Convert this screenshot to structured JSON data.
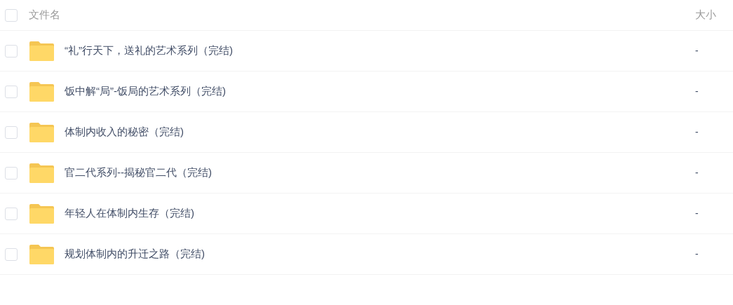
{
  "header": {
    "checked": false,
    "columns": [
      "文件名",
      "大小"
    ]
  },
  "rows": [
    {
      "checked": false,
      "name": "“礼”行天下，送礼的艺术系列（完结)",
      "size": "-"
    },
    {
      "checked": false,
      "name": "饭中解“局”-饭局的艺术系列（完结)",
      "size": "-"
    },
    {
      "checked": false,
      "name": "体制内收入的秘密（完结)",
      "size": "-"
    },
    {
      "checked": false,
      "name": "官二代系列--揭秘官二代（完结)",
      "size": "-"
    },
    {
      "checked": false,
      "name": "年轻人在体制内生存（完结)",
      "size": "-"
    },
    {
      "checked": false,
      "name": "规划体制内的升迁之路（完结)",
      "size": "-"
    }
  ]
}
